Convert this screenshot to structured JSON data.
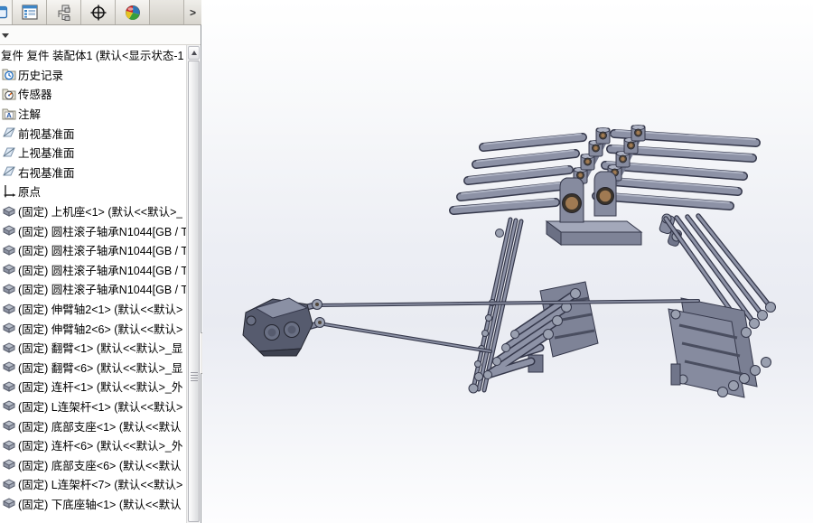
{
  "tabs": {
    "items": [
      {
        "icon": "featuremanager-tree-icon"
      },
      {
        "icon": "propertymanager-icon"
      },
      {
        "icon": "configurationmanager-icon"
      },
      {
        "icon": "dimxpert-icon"
      },
      {
        "icon": "displaymanager-icon"
      }
    ],
    "overflow_label": ">"
  },
  "tree": {
    "root_label": "复件 复件 装配体1  (默认<显示状态-1",
    "items": [
      {
        "icon": "history-icon",
        "label": "历史记录"
      },
      {
        "icon": "sensors-icon",
        "label": "传感器"
      },
      {
        "icon": "annotations-icon",
        "label": "注解"
      },
      {
        "icon": "plane-icon",
        "label": "前视基准面"
      },
      {
        "icon": "plane-icon",
        "label": "上视基准面"
      },
      {
        "icon": "plane-icon",
        "label": "右视基准面"
      },
      {
        "icon": "origin-icon",
        "label": "原点"
      },
      {
        "icon": "part-icon",
        "label": "(固定) 上机座<1> (默认<<默认>_"
      },
      {
        "icon": "part-icon",
        "label": "(固定) 圆柱滚子轴承N1044[GB / T"
      },
      {
        "icon": "part-icon",
        "label": "(固定) 圆柱滚子轴承N1044[GB / T"
      },
      {
        "icon": "part-icon",
        "label": "(固定) 圆柱滚子轴承N1044[GB / T"
      },
      {
        "icon": "part-icon",
        "label": "(固定) 圆柱滚子轴承N1044[GB / T"
      },
      {
        "icon": "part-icon",
        "label": "(固定) 伸臂轴2<1> (默认<<默认>"
      },
      {
        "icon": "part-icon",
        "label": "(固定) 伸臂轴2<6> (默认<<默认>"
      },
      {
        "icon": "part-icon",
        "label": "(固定) 翻臂<1> (默认<<默认>_显"
      },
      {
        "icon": "part-icon",
        "label": "(固定) 翻臂<6> (默认<<默认>_显"
      },
      {
        "icon": "part-icon",
        "label": "(固定) 连杆<1> (默认<<默认>_外"
      },
      {
        "icon": "part-icon",
        "label": "(固定) L连架杆<1> (默认<<默认>"
      },
      {
        "icon": "part-icon",
        "label": "(固定) 底部支座<1> (默认<<默认"
      },
      {
        "icon": "part-icon",
        "label": "(固定) 连杆<6> (默认<<默认>_外"
      },
      {
        "icon": "part-icon",
        "label": "(固定) 底部支座<6> (默认<<默认"
      },
      {
        "icon": "part-icon",
        "label": "(固定) L连架杆<7> (默认<<默认>"
      },
      {
        "icon": "part-icon",
        "label": "(固定) 下底座轴<1> (默认<<默认"
      }
    ]
  },
  "viewport": {
    "colors": {
      "model_body": "#8d92a6",
      "model_light": "#aeb3c4",
      "model_dark": "#70758a",
      "outline": "#34374a",
      "bearing_bronze": "#a07a52",
      "gearbox_dark": "#565b6e",
      "background_mid": "#e9ebf2"
    }
  }
}
